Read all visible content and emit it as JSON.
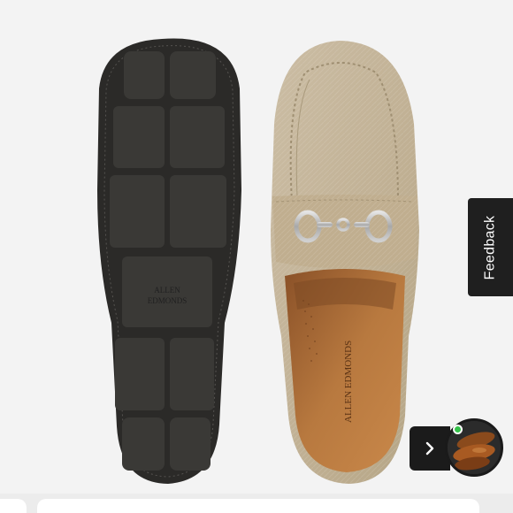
{
  "feedback": {
    "label": "Feedback"
  },
  "brand": {
    "sole_stamp_line1": "ALLEN",
    "sole_stamp_line2": "EDMONDS",
    "insole_text": "ALLEN EDMONDS"
  },
  "icons": {
    "next": "chevron-right-icon",
    "status": "online-status-dot"
  },
  "colors": {
    "sole": "#2b2a28",
    "suede": "#c4b59c",
    "insole": "#b0723f",
    "feedback_bg": "#1f1f1f",
    "status_dot": "#34c24a"
  }
}
